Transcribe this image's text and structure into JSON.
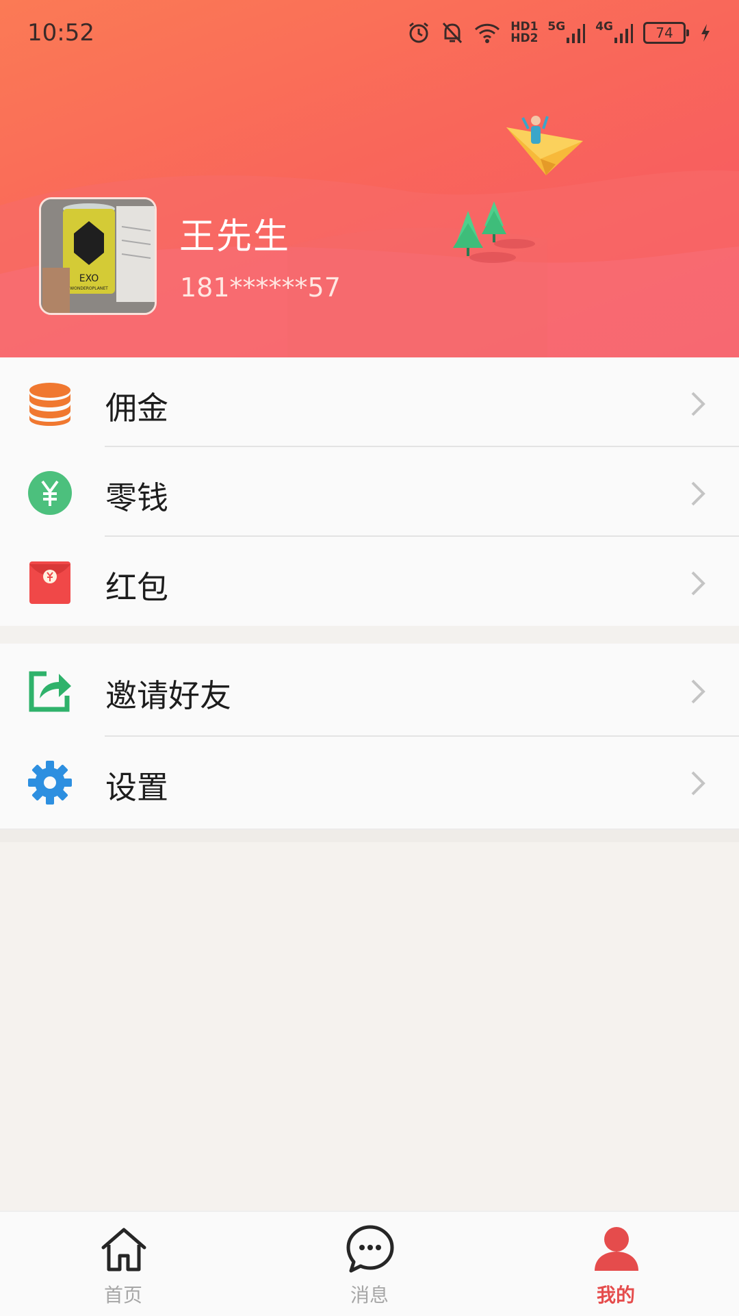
{
  "status_bar": {
    "time": "10:52",
    "icons": [
      "alarm-icon",
      "bell-off-icon",
      "wifi-icon",
      "hd-icon",
      "signal-5g-icon",
      "signal-4g-icon",
      "battery-icon",
      "charging-icon"
    ],
    "hd_label_1": "HD1",
    "hd_label_2": "HD2",
    "signal_label_1": "5G",
    "signal_label_2": "4G",
    "battery_level": "74"
  },
  "profile": {
    "name": "王先生",
    "phone": "181******57",
    "avatar_icon": "user-photo",
    "avatar_text_1": "EXO",
    "avatar_text_2": "WONDEROPLANET"
  },
  "menu_group_1": [
    {
      "label": "佣金",
      "icon": "coins-stack-icon",
      "color": "#f07830"
    },
    {
      "label": "零钱",
      "icon": "yuan-icon",
      "color": "#4cc07d"
    },
    {
      "label": "红包",
      "icon": "red-envelope-icon",
      "color": "#f04848"
    }
  ],
  "menu_group_2": [
    {
      "label": "邀请好友",
      "icon": "share-icon",
      "color": "#2fb26b"
    },
    {
      "label": "设置",
      "icon": "gear-icon",
      "color": "#2d8fe0"
    }
  ],
  "bottom_nav": [
    {
      "label": "首页",
      "icon": "home-icon",
      "active": false
    },
    {
      "label": "消息",
      "icon": "message-icon",
      "active": false
    },
    {
      "label": "我的",
      "icon": "profile-icon",
      "active": true
    }
  ],
  "colors": {
    "header_start": "#fb7a55",
    "header_end": "#f75565",
    "active_nav": "#e54c4c",
    "inactive_nav": "#a6a6a6"
  }
}
